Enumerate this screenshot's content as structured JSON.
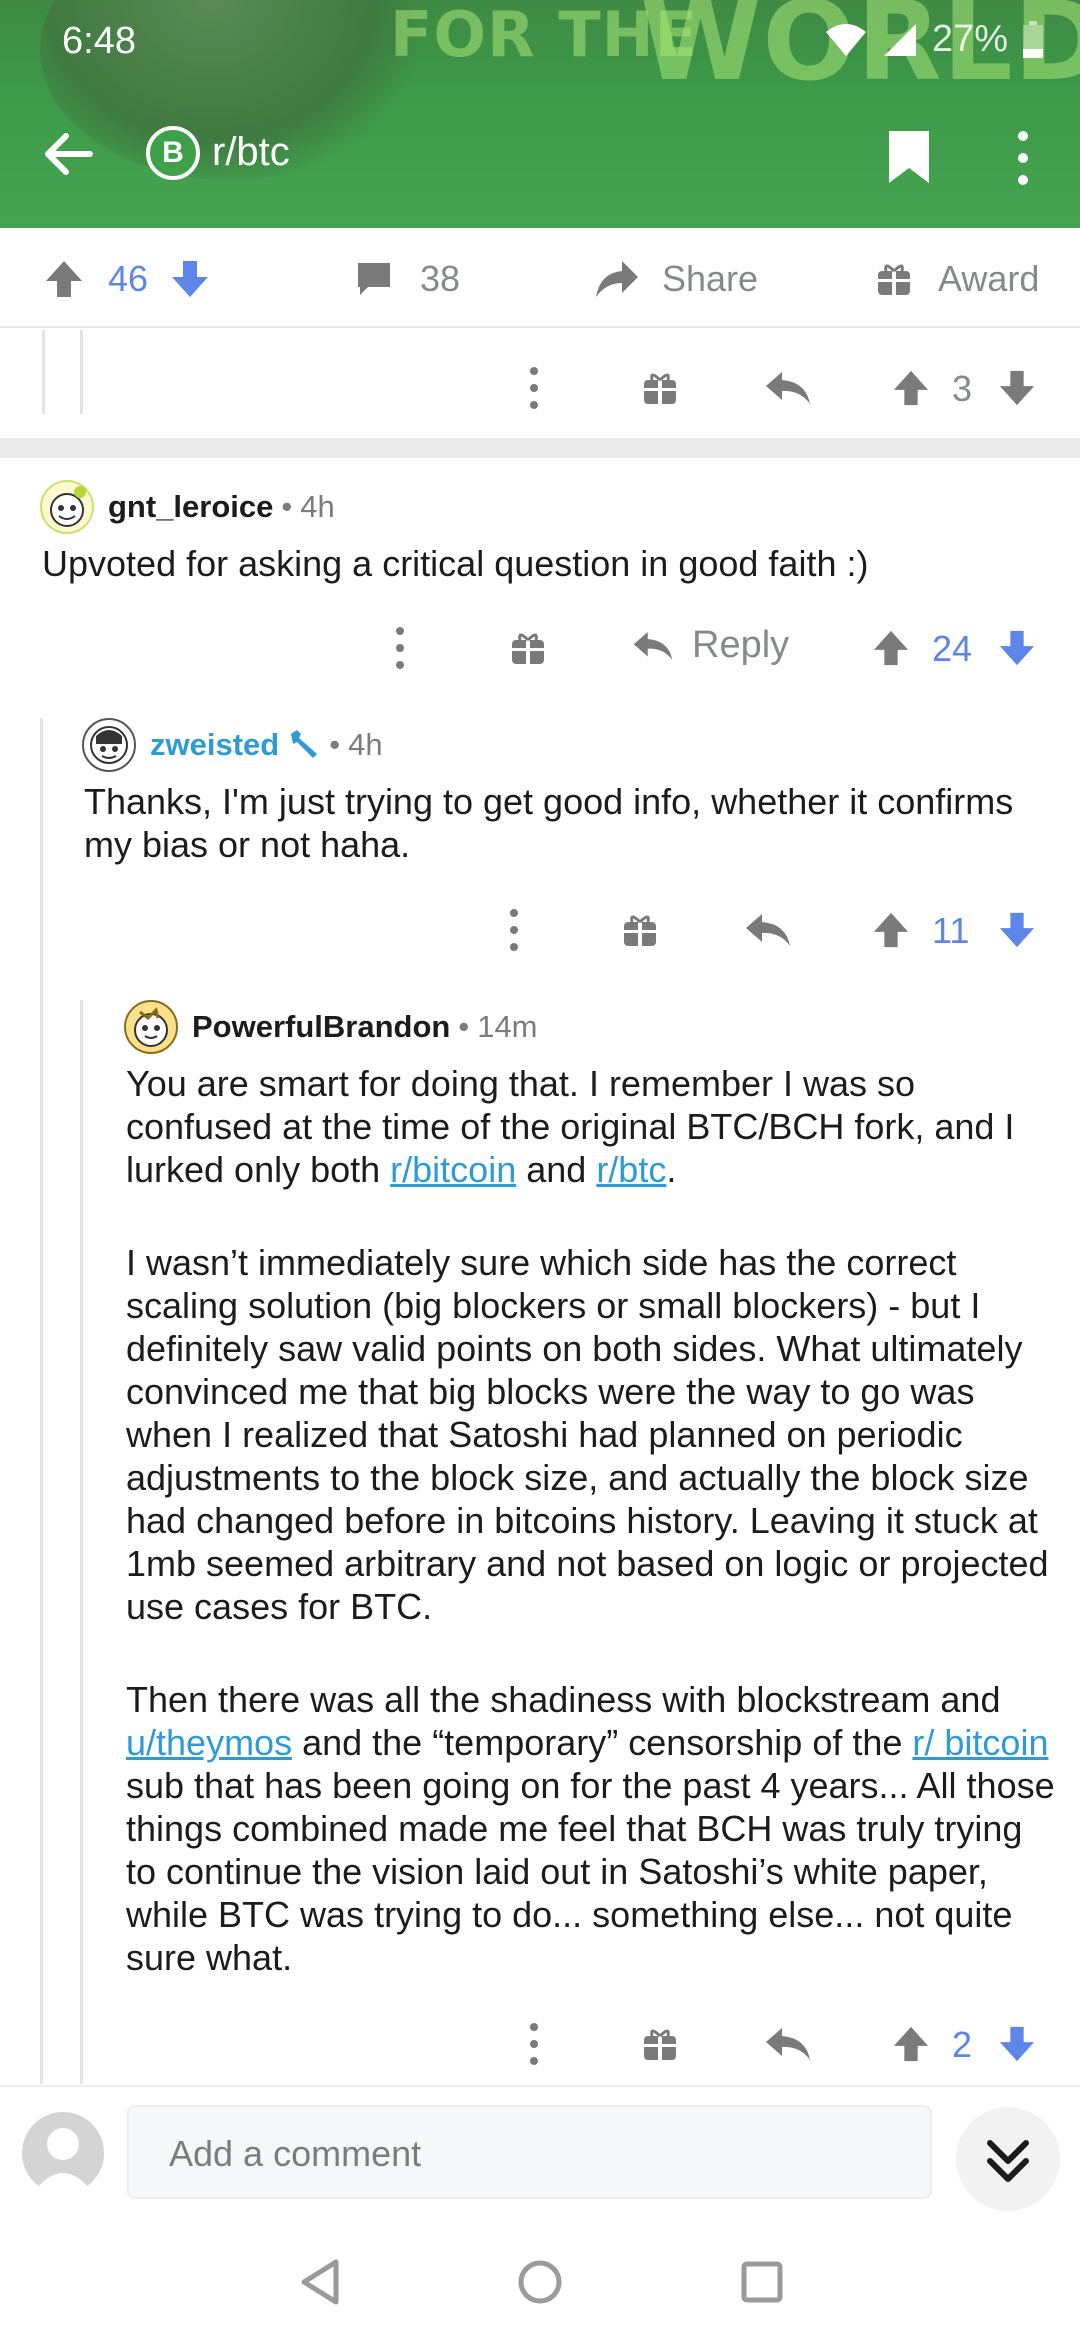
{
  "status_bar": {
    "time": "6:48",
    "battery": "27%"
  },
  "banner": {
    "line_small": "FOR THE",
    "line_big": "WORLD?"
  },
  "toolbar": {
    "subreddit": "r/btc",
    "sub_icon_letter": "B"
  },
  "post_actions": {
    "upvotes": "46",
    "comments": "38",
    "share": "Share",
    "award": "Award"
  },
  "prev_comment": {
    "votes": "3"
  },
  "comments": [
    {
      "username": "gnt_leroice",
      "separator": "•",
      "time": "4h",
      "body": "Upvoted for asking a critical question in good faith :)",
      "reply_label": "Reply",
      "votes": "24"
    },
    {
      "username": "zweisted",
      "separator": "•",
      "time": "4h",
      "body": "Thanks, I'm just trying to get good info, whether it confirms my bias or not haha.",
      "votes": "11"
    },
    {
      "username": "PowerfulBrandon",
      "separator": "•",
      "time": "14m",
      "p1_a": "You are smart for doing that. I remember I was so confused at the time of the original BTC/BCH fork, and I lurked only both ",
      "p1_link1": "r/bitcoin",
      "p1_b": " and ",
      "p1_link2": "r/btc",
      "p1_c": ".",
      "p2": "I wasn’t immediately sure which side has the correct scaling solution (big blockers or small blockers) - but I definitely saw valid points on both sides. What ultimately convinced me that big blocks were the way to go was when I realized that Satoshi had planned on periodic adjustments to the block size, and actually the block size had changed before in bitcoins history. Leaving it stuck at 1mb seemed arbitrary and not based on logic or projected use cases for BTC.",
      "p3_a": "Then there was all the shadiness with blockstream and ",
      "p3_link1": "u/theymos",
      "p3_b": " and the “temporary” censorship of the ",
      "p3_link2": "r/ bitcoin",
      "p3_c": " sub that has been going on for the past 4 years... All those things combined made me feel that BCH was truly trying to continue the vision laid out in Satoshi’s white paper, while BTC was trying to do... something else... not quite sure what.",
      "votes": "2"
    }
  ],
  "bottom": {
    "comment_placeholder": "Add a comment"
  },
  "colors": {
    "header_green": "#46a451",
    "vote_blue": "#5d86e8",
    "link_blue": "#2f9bd6"
  }
}
